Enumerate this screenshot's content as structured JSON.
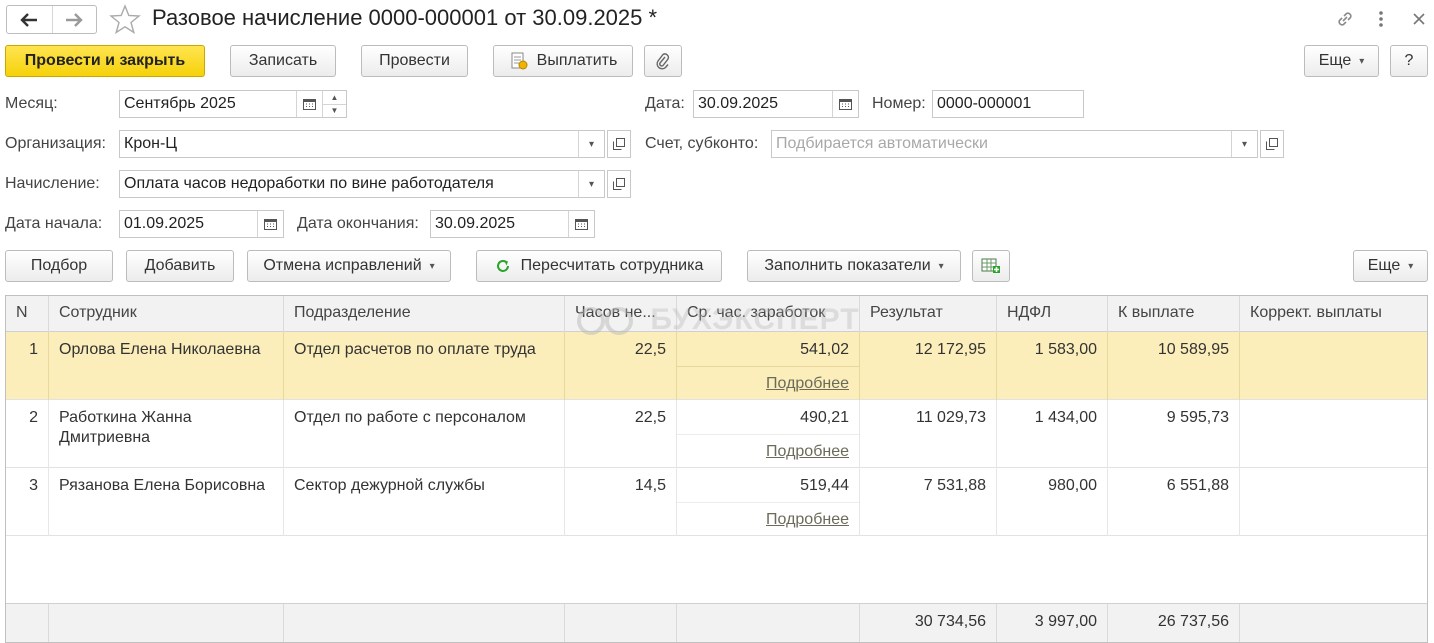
{
  "window": {
    "title": "Разовое начисление 0000-000001 от 30.09.2025 *"
  },
  "toolbar": {
    "post_close": "Провести и закрыть",
    "save": "Записать",
    "post": "Провести",
    "pay": "Выплатить",
    "more": "Еще",
    "help": "?"
  },
  "form": {
    "month_label": "Месяц:",
    "month_value": "Сентябрь 2025",
    "date_label": "Дата:",
    "date_value": "30.09.2025",
    "number_label": "Номер:",
    "number_value": "0000-000001",
    "org_label": "Организация:",
    "org_value": "Крон-Ц",
    "account_label": "Счет, субконто:",
    "account_placeholder": "Подбирается автоматически",
    "accrual_label": "Начисление:",
    "accrual_value": "Оплата часов недоработки по вине работодателя",
    "start_label": "Дата начала:",
    "start_value": "01.09.2025",
    "end_label": "Дата окончания:",
    "end_value": "30.09.2025"
  },
  "table_toolbar": {
    "select": "Подбор",
    "add": "Добавить",
    "cancel_fix": "Отмена исправлений",
    "recalc": "Пересчитать сотрудника",
    "fill": "Заполнить показатели",
    "more": "Еще"
  },
  "table": {
    "columns": [
      "N",
      "Сотрудник",
      "Подразделение",
      "Часов не...",
      "Ср. час. заработок",
      "Результат",
      "НДФЛ",
      "К выплате",
      "Коррект. выплаты"
    ],
    "more_link": "Подробнее",
    "rows": [
      {
        "n": "1",
        "employee": "Орлова Елена Николаевна",
        "dept": "Отдел расчетов по оплате труда",
        "hours": "22,5",
        "avg": "541,02",
        "result": "12 172,95",
        "ndfl": "1 583,00",
        "payout": "10 589,95",
        "corr": ""
      },
      {
        "n": "2",
        "employee": "Работкина Жанна Дмитриевна",
        "dept": "Отдел по работе с персоналом",
        "hours": "22,5",
        "avg": "490,21",
        "result": "11 029,73",
        "ndfl": "1 434,00",
        "payout": "9 595,73",
        "corr": ""
      },
      {
        "n": "3",
        "employee": "Рязанова Елена Борисовна",
        "dept": "Сектор дежурной службы",
        "hours": "14,5",
        "avg": "519,44",
        "result": "7 531,88",
        "ndfl": "980,00",
        "payout": "6 551,88",
        "corr": ""
      }
    ],
    "totals": {
      "result": "30 734,56",
      "ndfl": "3 997,00",
      "payout": "26 737,56"
    }
  },
  "watermark": "БУХЭКСПЕРТ"
}
